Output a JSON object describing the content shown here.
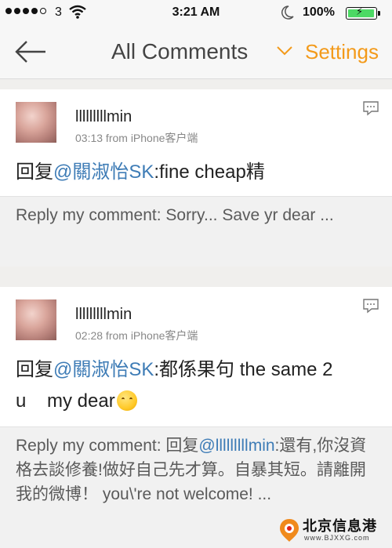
{
  "status_bar": {
    "carrier": "3",
    "time": "3:21 AM",
    "battery": "100%",
    "battery_level": 1.0
  },
  "nav": {
    "title": "All Comments",
    "settings": "Settings",
    "back_icon": "back-arrow-icon",
    "dropdown_icon": "chevron-down-icon"
  },
  "comments": [
    {
      "username": "lllllllllmin",
      "meta": "03:13  from iPhone客户端",
      "prefix": "回复",
      "mention": "@關淑怡SK",
      "text": ":fine cheap精",
      "quote": "Reply my comment: Sorry... Save yr dear ..."
    },
    {
      "username": "lllllllllmin",
      "meta": "02:28  from iPhone客户端",
      "prefix": "回复",
      "mention": "@關淑怡SK",
      "text_line1": ":都係果句 the same 2",
      "text_line2": "u    my dear",
      "quote_prefix": "Reply my comment: 回复",
      "quote_mention": "@lllllllllmin",
      "quote_rest": ":還有,你沒資格去談修養!做好自己先才算。自暴其短。請離開我的微博！ you\\'re not welcome! ..."
    }
  ],
  "watermark": {
    "title": "北京信息港",
    "url": "www.BJXXG.com"
  },
  "colors": {
    "accent": "#f39a1a",
    "mention": "#3e7cb6",
    "battery": "#4cd964"
  }
}
